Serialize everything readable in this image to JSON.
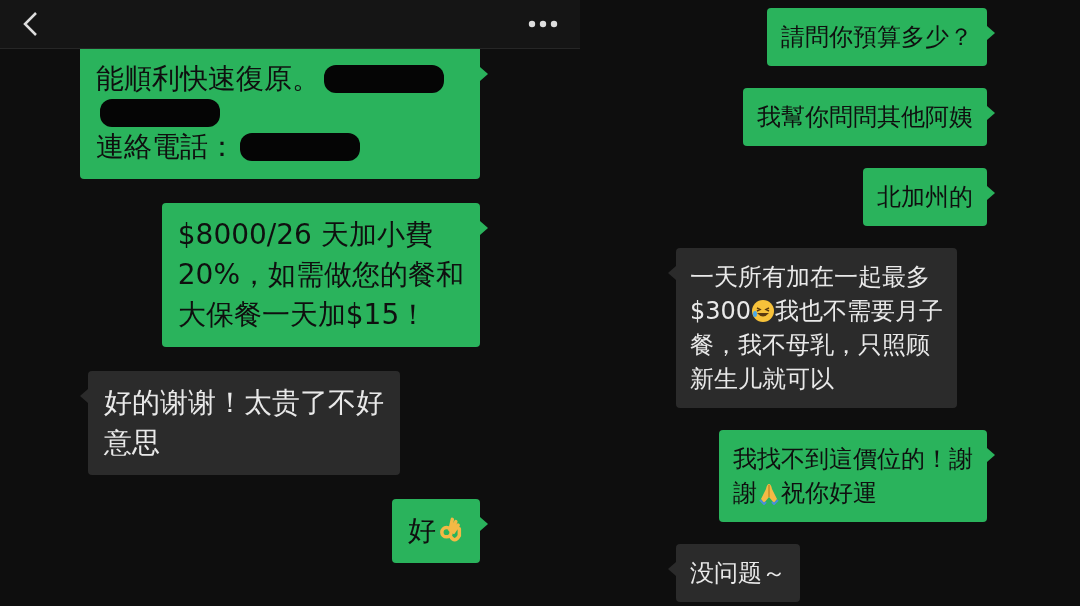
{
  "chats": [
    {
      "kind": "header",
      "messages": [
        {
          "outgoing": true,
          "lines": [
            [
              {
                "kind": "text",
                "text": "能順利快速復原。"
              },
              {
                "kind": "redacted"
              }
            ],
            [
              {
                "kind": "redacted"
              }
            ],
            [
              {
                "kind": "text",
                "text": "連絡電話："
              },
              {
                "kind": "redacted"
              }
            ]
          ]
        },
        {
          "outgoing": true,
          "lines": [
            [
              {
                "kind": "text",
                "text": "$8000/26 天加小費"
              }
            ],
            [
              {
                "kind": "text",
                "text": "20%，如需做您的餐和"
              }
            ],
            [
              {
                "kind": "text",
                "text": "大保餐一天加$15！"
              }
            ]
          ]
        },
        {
          "outgoing": false,
          "lines": [
            [
              {
                "kind": "text",
                "text": "好的谢谢！太贵了不好"
              }
            ],
            [
              {
                "kind": "text",
                "text": "意思"
              }
            ]
          ]
        },
        {
          "outgoing": true,
          "lines": [
            [
              {
                "kind": "text",
                "text": "好"
              },
              {
                "kind": "ok"
              }
            ]
          ]
        }
      ]
    },
    {
      "kind": "plain",
      "messages": [
        {
          "outgoing": true,
          "lines": [
            [
              {
                "kind": "text",
                "text": "請問你預算多少？"
              }
            ]
          ]
        },
        {
          "outgoing": true,
          "lines": [
            [
              {
                "kind": "text",
                "text": "我幫你問問其他阿姨"
              }
            ]
          ]
        },
        {
          "outgoing": true,
          "lines": [
            [
              {
                "kind": "text",
                "text": "北加州的"
              }
            ]
          ]
        },
        {
          "outgoing": false,
          "lines": [
            [
              {
                "kind": "text",
                "text": "一天所有加在一起最多"
              }
            ],
            [
              {
                "kind": "text",
                "text": "$300"
              },
              {
                "kind": "laugh"
              },
              {
                "kind": "text",
                "text": "我也不需要月子"
              }
            ],
            [
              {
                "kind": "text",
                "text": "餐，我不母乳，只照顾"
              }
            ],
            [
              {
                "kind": "text",
                "text": "新生儿就可以"
              }
            ]
          ]
        },
        {
          "outgoing": true,
          "lines": [
            [
              {
                "kind": "text",
                "text": "我找不到這價位的！謝"
              }
            ],
            [
              {
                "kind": "text",
                "text": "謝"
              },
              {
                "kind": "pray"
              },
              {
                "kind": "text",
                "text": "祝你好運"
              }
            ]
          ]
        },
        {
          "outgoing": false,
          "lines": [
            [
              {
                "kind": "text",
                "text": "没问题～"
              }
            ]
          ]
        }
      ]
    }
  ]
}
